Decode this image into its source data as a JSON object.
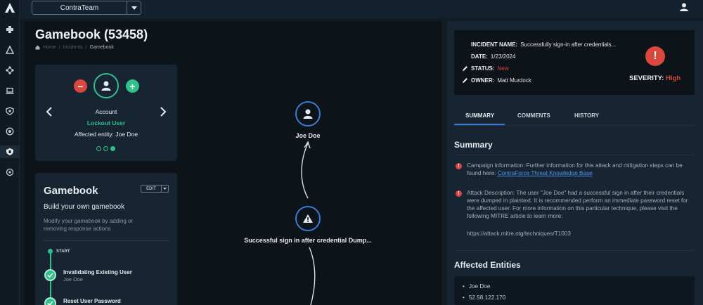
{
  "topbar": {
    "team": "ContraTeam"
  },
  "page": {
    "title": "Gamebook (53458)",
    "breadcrumbs": [
      "Home",
      "Incidents",
      "Gamebook"
    ]
  },
  "entity_card": {
    "type": "Account",
    "status": "Lockout User",
    "affected": "Affected entity: Joe Doe"
  },
  "gamebook": {
    "title": "Gamebook",
    "edit_label": "EDIT",
    "subtitle": "Build your own gamebook",
    "description": "Modify your gamebook by adding or removing response actions",
    "start_label": "START",
    "steps": [
      {
        "title": "Invalidating Existing User",
        "sub": "Joe Doe"
      },
      {
        "title": "Reset User Password",
        "sub": ""
      }
    ]
  },
  "flow": {
    "user_node_label": "Joe Doe",
    "alert_node_label": "Successful sign in after credential Dump..."
  },
  "incident": {
    "name_label": "INCIDENT NAME:",
    "name": "Successfully sign-in after credentials...",
    "date_label": "DATE:",
    "date": "1/23/2024",
    "status_label": "STATUS:",
    "status": "New",
    "owner_label": "OWNER:",
    "owner": "Matt Murdock",
    "severity_label": "SEVERITY:",
    "severity": "High"
  },
  "tabs": [
    "SUMMARY",
    "COMMENTS",
    "HISTORY"
  ],
  "summary": {
    "title": "Summary",
    "campaign_text": "Campaign information: Further information for this attack and mitigation steps can be found here: ",
    "campaign_link": "ContraForce Threat Knowledge Base",
    "attack_text": "Attack Description: The user \"Joe Doe\" had a successful sign in after their credentials were dumped in plaintext. It is recommended perform an immediate password reset for the affected user. For more information on this particular technique, please visit the following MITRE article to learn more:",
    "url": "https://attack.mitre.otg/techniques/T1003"
  },
  "affected_entities": {
    "title": "Affected Entities",
    "items": [
      "Joe Doe",
      "52.58.122.170"
    ]
  },
  "colors": {
    "accent_green": "#2fc08c",
    "accent_red": "#d9473f",
    "accent_blue": "#3a7bd5"
  }
}
